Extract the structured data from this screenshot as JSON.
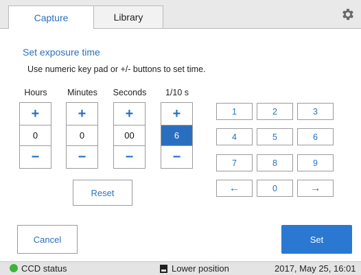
{
  "tabs": [
    {
      "label": "Capture",
      "active": true
    },
    {
      "label": "Library",
      "active": false
    }
  ],
  "settings_icon": "gear-icon",
  "dialog": {
    "title": "Set exposure time",
    "instructions": "Use numeric key pad or +/- buttons to set time.",
    "steppers": [
      {
        "label": "Hours",
        "value": "0",
        "plus": "+",
        "minus": "−"
      },
      {
        "label": "Minutes",
        "value": "0",
        "plus": "+",
        "minus": "−"
      },
      {
        "label": "Seconds",
        "value": "00",
        "plus": "+",
        "minus": "−"
      },
      {
        "label": "1/10 s",
        "value": "6",
        "plus": "+",
        "minus": "−",
        "selected": true
      }
    ],
    "keypad": {
      "keys": [
        "1",
        "2",
        "3",
        "4",
        "5",
        "6",
        "7",
        "8",
        "9",
        "←",
        "0",
        "→"
      ],
      "left_arrow_icon": "arrow-left-icon",
      "right_arrow_icon": "arrow-right-icon"
    },
    "reset_label": "Reset",
    "cancel_label": "Cancel",
    "set_label": "Set"
  },
  "status_bar": {
    "ccd_label": "CCD status",
    "ccd_color": "#3cb43c",
    "position_icon": "tray-icon",
    "position_label": "Lower position",
    "datetime": "2017, May 25, 16:01"
  },
  "colors": {
    "accent": "#2a6fbf",
    "primary_button": "#2a78d2"
  }
}
